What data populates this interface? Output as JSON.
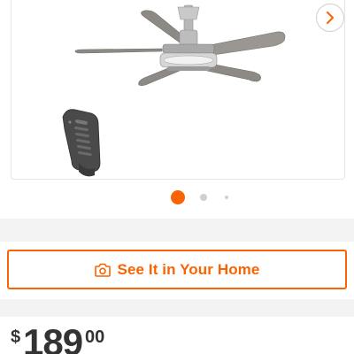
{
  "product": {
    "name": "",
    "image_icon": "ceiling-fan-with-remote"
  },
  "carousel": {
    "next_icon": "chevron-right-icon",
    "slide_count": 3,
    "active_index": 0
  },
  "see_it": {
    "label": "See It in Your Home",
    "icon": "camera-icon"
  },
  "price": {
    "currency": "$",
    "dollars": "189",
    "cents": "00"
  },
  "colors": {
    "accent": "#f96302",
    "text": "#333333",
    "band": "#f3f3f3",
    "dot_inactive": "#d0d0d0"
  }
}
